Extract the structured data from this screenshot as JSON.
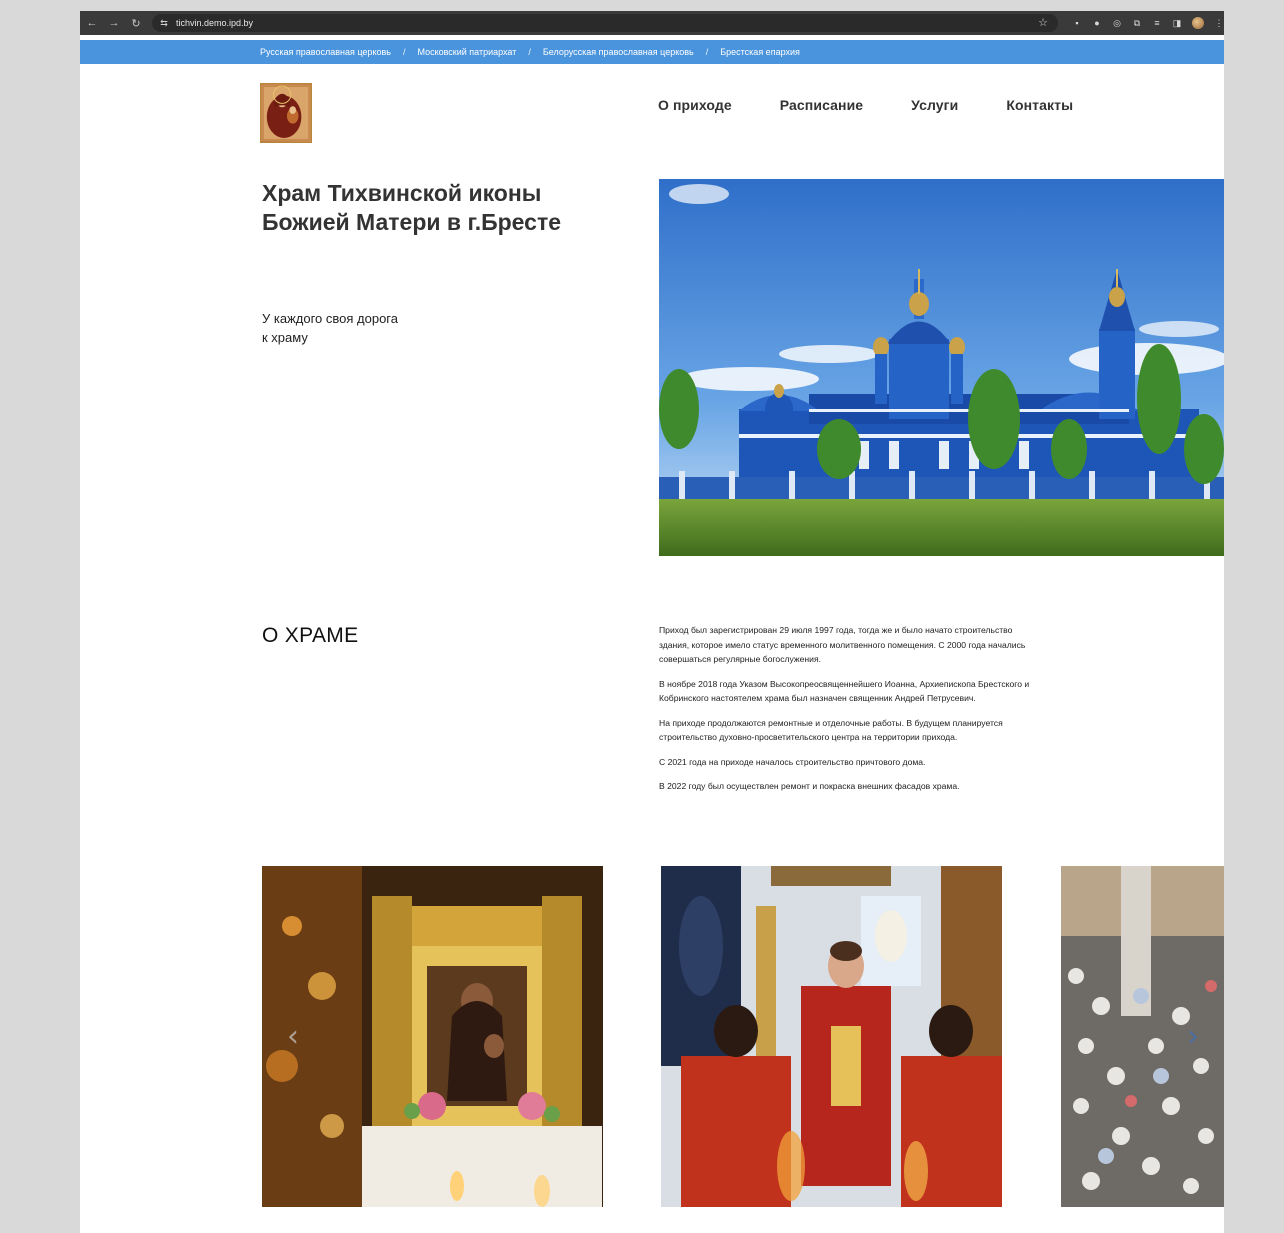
{
  "browser": {
    "url": "tichvin.demo.ipd.by"
  },
  "topbar": {
    "crumbs": [
      "Русская православная церковь",
      "Московский патриархат",
      "Белорусская православная церковь",
      "Брестская епархия"
    ],
    "separator": "/"
  },
  "nav": {
    "items": [
      "О приходе",
      "Расписание",
      "Услуги",
      "Контакты"
    ]
  },
  "hero": {
    "title": "Храм Тихвинской иконы Божией Матери в г.Бресте",
    "subtitle_line1": "У каждого своя дорога",
    "subtitle_line2": "к храму"
  },
  "about": {
    "title": "О ХРАМЕ",
    "paragraphs": [
      "Приход был зарегистрирован 29 июля 1997 года, тогда же и было начато строительство здания, которое имело статус временного молитвенного помещения. С 2000 года начались совершаться регулярные богослужения.",
      "В ноябре 2018 года Указом Высокопреосвященнейшего Иоанна, Архиепископа Брестского и Кобринского настоятелем храма был назначен священник Андрей Петрусевич.",
      "На приходе продолжаются ремонтные и отделочные работы. В будущем планируется строительство духовно-просветительского центра на территории прихода.",
      "С 2021 года на приходе началось строительство причтового дома.",
      "В 2022 году был осуществлен ремонт и покраска внешних фасадов храма."
    ]
  },
  "gallery": {
    "prev_icon": "chevron-left-icon",
    "next_icon": "chevron-right-icon",
    "active_dot": 0,
    "dot_count": 3
  },
  "colors": {
    "topbar": "#4a94dd",
    "text": "#333333",
    "accent": "#2d7fd6"
  }
}
